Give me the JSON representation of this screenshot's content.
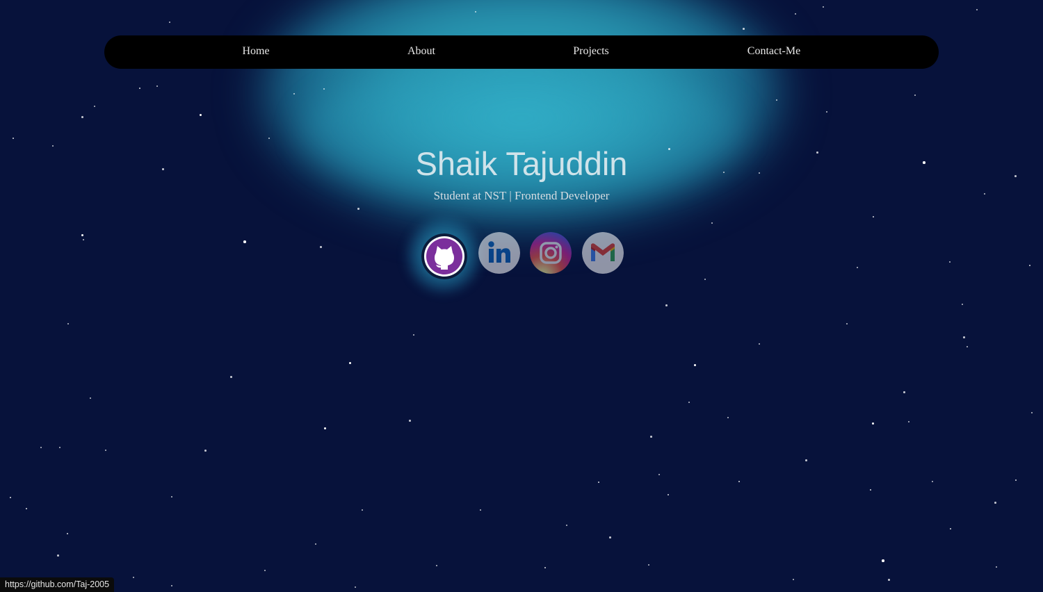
{
  "nav": {
    "items": [
      {
        "label": "Home"
      },
      {
        "label": "About"
      },
      {
        "label": "Projects"
      },
      {
        "label": "Contact-Me"
      }
    ]
  },
  "hero": {
    "name": "Shaik Tajuddin",
    "subtitle": "Student at NST | Frontend Developer"
  },
  "socials": [
    {
      "icon": "github-icon",
      "color": "#7b2f9c"
    },
    {
      "icon": "linkedin-icon",
      "color": "#0a66c2"
    },
    {
      "icon": "instagram-icon",
      "color": "#d6249f"
    },
    {
      "icon": "gmail-icon",
      "color": "#ea4335"
    }
  ],
  "status_bar": {
    "url": "https://github.com/Taj-2005"
  },
  "colors": {
    "background": "#07123b",
    "glow": "#2da3bb",
    "navbar": "#000000"
  }
}
